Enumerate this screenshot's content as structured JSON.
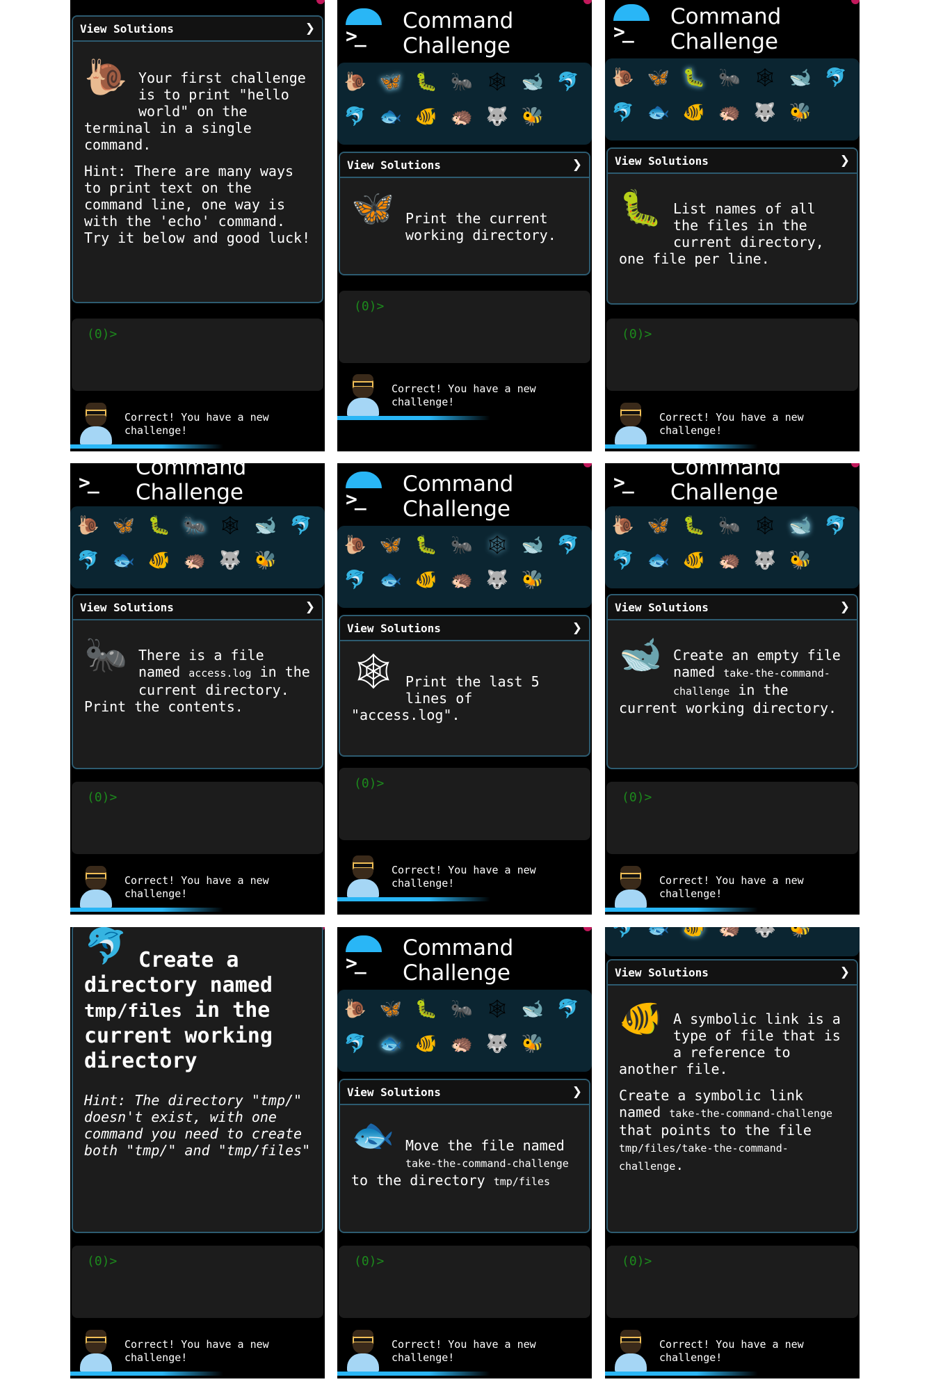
{
  "common": {
    "app_title_line1": "Command",
    "app_title_line2": "Challenge",
    "view_solutions": "View Solutions",
    "chevron": "❯",
    "prompt": "(0)>",
    "feedback": "Correct! You have a new challenge!"
  },
  "emojis": [
    "🐌",
    "🦋",
    "🐛",
    "🐜",
    "🕸",
    "🐋",
    "🐬",
    "🐬",
    "🐟",
    "🐠",
    "🦔",
    "🐺",
    "🐝"
  ],
  "emoji_names": [
    "snail-icon",
    "butterfly-icon",
    "caterpillar-icon",
    "ant-icon",
    "spider-web-icon",
    "whale-icon",
    "dolphin-icon",
    "dolphin-icon-2",
    "fish-icon",
    "tropical-fish-icon",
    "hedgehog-icon",
    "wolf-icon",
    "bee-icon"
  ],
  "screens": [
    {
      "icon": "🐌",
      "icon_name": "snail-icon",
      "prompt_text": "Your first challenge is to print \"hello world\" on the terminal in a single command.",
      "hint": "Hint: There are many ways to print text on the command line, one way is with the 'echo' command. Try it below and good luck!"
    },
    {
      "icon": "🦋",
      "icon_name": "butterfly-icon",
      "prompt_text": "Print the current working directory."
    },
    {
      "icon": "🐛",
      "icon_name": "caterpillar-icon",
      "prompt_text": "List names of all the files in the current directory, one file per line."
    },
    {
      "icon": "🐜",
      "icon_name": "ant-icon",
      "text_a": "There is a file named ",
      "code_a": "access.log",
      "text_b": " in the current directory. Print the contents."
    },
    {
      "icon": "🕸",
      "icon_name": "spider-web-icon",
      "prompt_text": "Print the last 5 lines of \"access.log\"."
    },
    {
      "icon": "🐋",
      "icon_name": "whale-icon",
      "text_a": "Create an empty file named ",
      "code_a": "take-the-command-challenge",
      "text_b": " in the current working directory."
    },
    {
      "icon": "🐬",
      "icon_name": "dolphin-icon",
      "heading_a": "Create a directory named ",
      "heading_code": "tmp/files",
      "heading_b": " in the current working directory",
      "hint": "Hint: The directory \"tmp/\" doesn't exist, with one command you need to create both \"tmp/\" and \"tmp/files\""
    },
    {
      "icon": "🐟",
      "icon_name": "fish-icon",
      "text_a": "Move the file named ",
      "code_a": "take-the-command-challenge",
      "text_b": " to the directory ",
      "code_b": "tmp/files"
    },
    {
      "icon": "🐠",
      "icon_name": "tropical-fish-icon",
      "text_a": "A symbolic link is a type of file that is a reference to another file.",
      "text_b": "Create a symbolic link named ",
      "code_a": "take-the-command-challenge",
      "text_c": " that points to the file ",
      "code_b": "tmp/files/take-the-command-challenge",
      "text_d": "."
    }
  ],
  "colors": {
    "accent": "#29b6f6",
    "card_bg": "#1c1c1c",
    "card_border": "#2d5b70",
    "emoji_bar_bg": "#0b2531",
    "prompt_green": "#1c8a1c",
    "notification_dot": "#c2185b"
  }
}
